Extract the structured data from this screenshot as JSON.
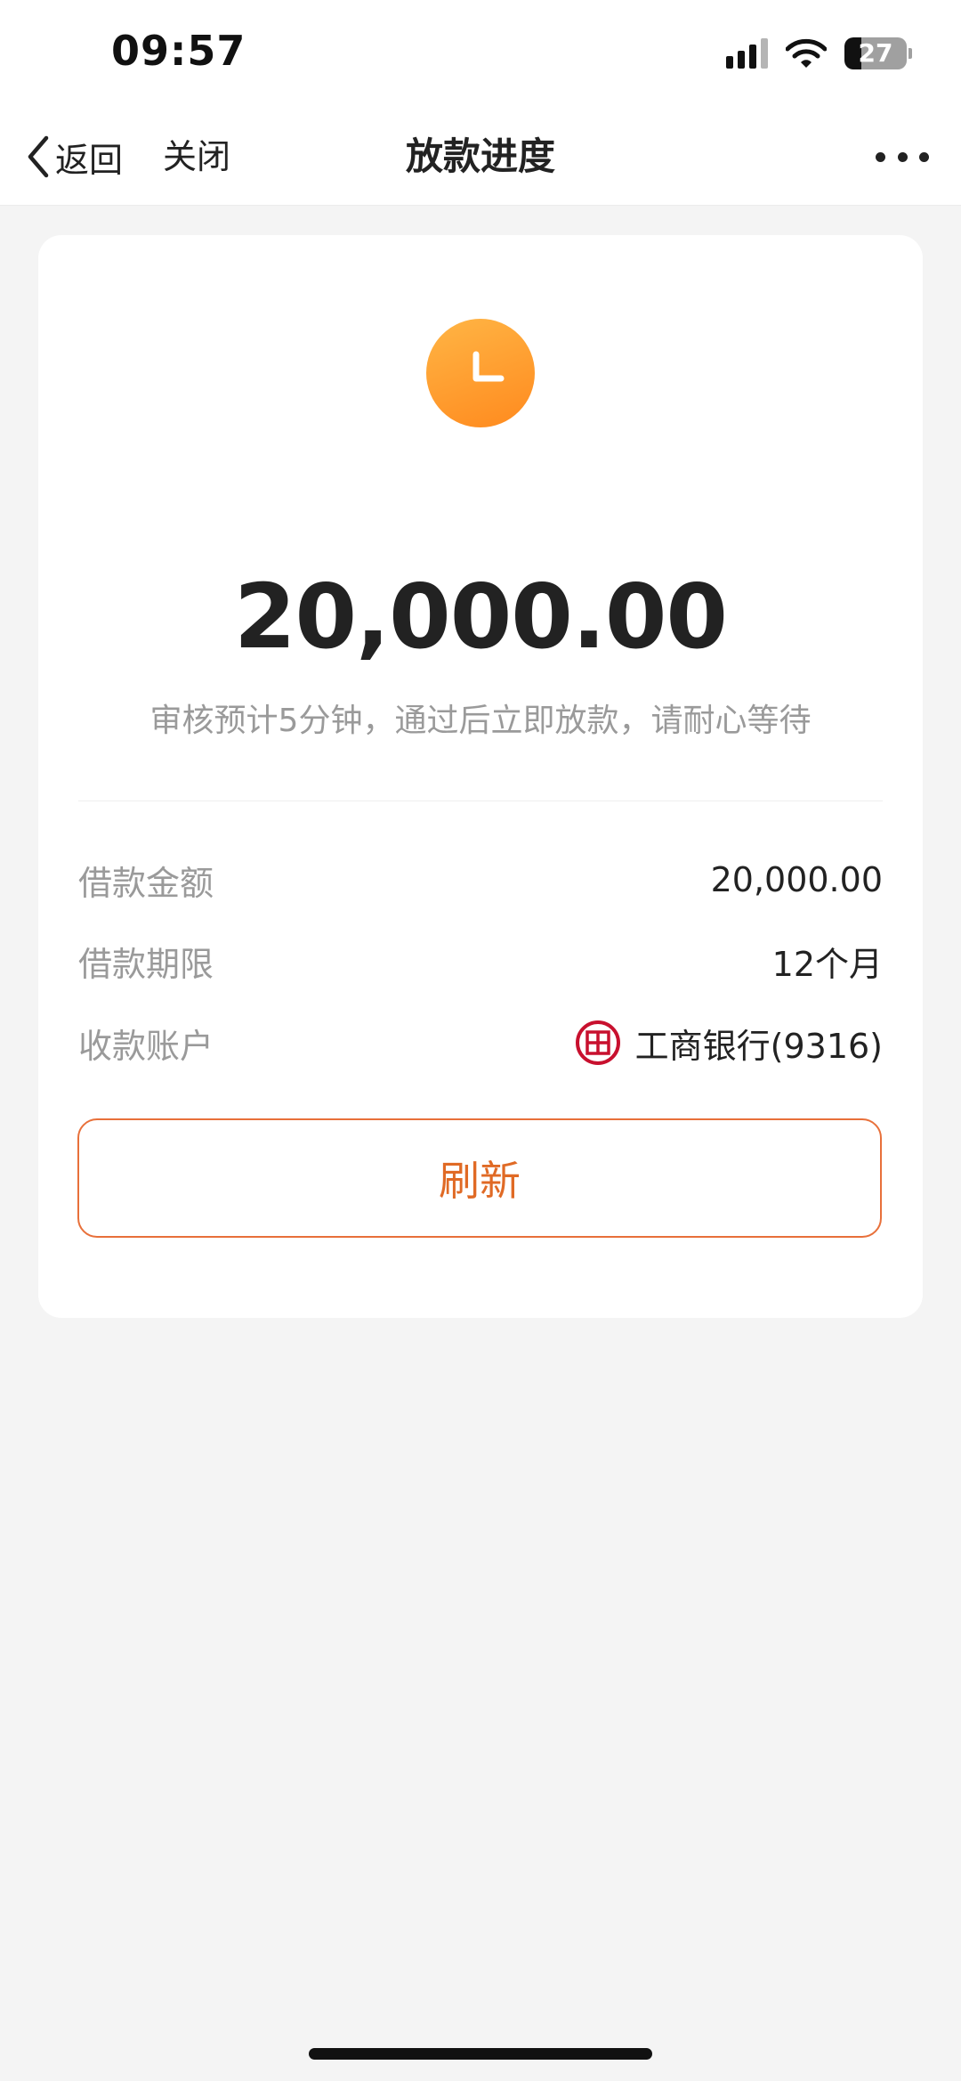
{
  "status_bar": {
    "time": "09:57",
    "battery_level": "27"
  },
  "nav": {
    "back_label": "返回",
    "close_label": "关闭",
    "title": "放款进度"
  },
  "progress": {
    "status_icon": "clock-icon",
    "amount": "20,000.00",
    "notice": "审核预计5分钟，通过后立即放款，请耐心等待"
  },
  "details": [
    {
      "label": "借款金额",
      "value": "20,000.00"
    },
    {
      "label": "借款期限",
      "value": "12个月"
    },
    {
      "label": "收款账户",
      "value": "工商银行(9316)",
      "icon": "icbc-bank-icon"
    }
  ],
  "refresh_label": "刷新",
  "colors": {
    "accent": "#e06a25",
    "clock_gradient_start": "#ffb545",
    "clock_gradient_end": "#ff8a1e",
    "bank_red": "#c8102e"
  }
}
